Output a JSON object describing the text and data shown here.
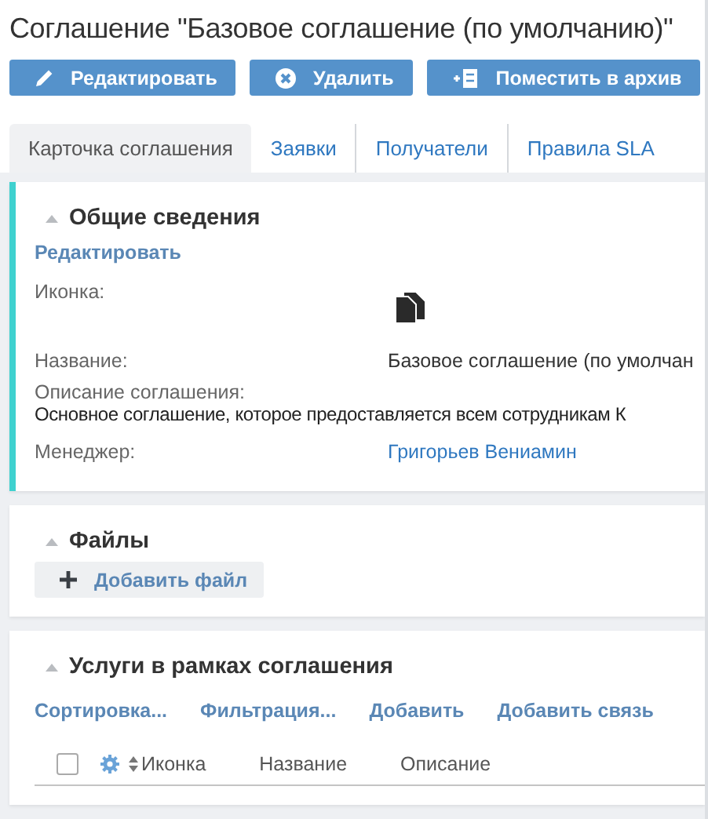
{
  "title": "Соглашение \"Базовое соглашение (по умолчанию)\"",
  "toolbar": [
    "Редактировать",
    "Удалить",
    "Поместить в архив"
  ],
  "tabs": [
    {
      "label": "Карточка соглашения",
      "selected": true
    },
    {
      "label": "Заявки",
      "selected": false
    },
    {
      "label": "Получатели",
      "selected": false
    },
    {
      "label": "Правила SLA",
      "selected": false
    }
  ],
  "sections": [
    {
      "kind": "details",
      "title": "Общие сведения",
      "expanded": true,
      "highlighted": true,
      "edit_link": "Редактировать",
      "fields": [
        {
          "kind": "icon",
          "label": "Иконка:"
        },
        {
          "kind": "text",
          "label": "Название:",
          "value": "Базовое соглашение (по умолчан"
        },
        {
          "kind": "block",
          "label": "Описание соглашения:",
          "value": "Основное соглашение, которое предоставляется всем сотрудникам К"
        },
        {
          "kind": "link",
          "label": "Менеджер:",
          "value": "Григорьев Вениамин"
        }
      ]
    },
    {
      "kind": "files",
      "title": "Файлы",
      "expanded": true,
      "highlighted": false,
      "add_button": "Добавить файл"
    },
    {
      "kind": "table",
      "title": "Услуги в рамках соглашения",
      "expanded": true,
      "highlighted": false,
      "actions": [
        "Сортировка...",
        "Фильтрация...",
        "Добавить",
        "Добавить связь"
      ],
      "select_all_checked": false,
      "columns": [
        "Иконка",
        "Название",
        "Описание"
      ]
    }
  ]
}
